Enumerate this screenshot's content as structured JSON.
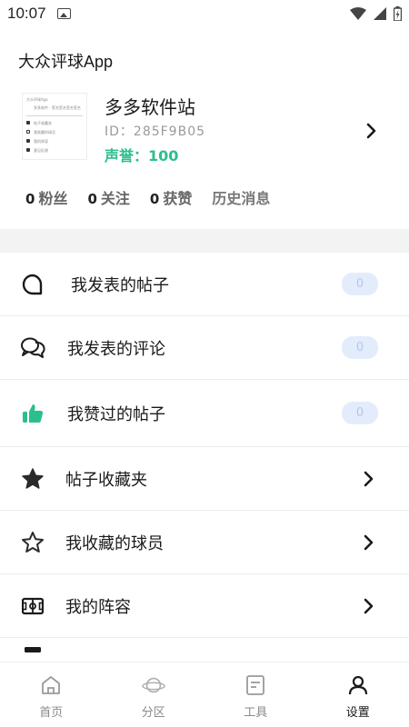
{
  "status_bar": {
    "time": "10:07",
    "icons": [
      "image-icon",
      "wifi-icon",
      "signal-icon",
      "battery-icon"
    ]
  },
  "app": {
    "title": "大众评球App"
  },
  "profile": {
    "name": "多多软件站",
    "id": "ID：285F9B05",
    "reputation": "声誉：100",
    "accent_color": "#2bbf8e",
    "thumbnail_lines": [
      "大众评球App",
      "多多软件 · 签名签名签名签名",
      "帖子收藏夹",
      "我收藏的球员",
      "我的阵容",
      "意见反馈"
    ]
  },
  "stats": [
    {
      "num": "0",
      "label": "粉丝"
    },
    {
      "num": "0",
      "label": "关注"
    },
    {
      "num": "0",
      "label": "获赞"
    }
  ],
  "history": "历史消息",
  "menu": [
    {
      "label": "我发表的帖子",
      "icon": "chat-bubble-icon",
      "badge": "0"
    },
    {
      "label": "我发表的评论",
      "icon": "comments-icon",
      "badge": "0"
    },
    {
      "label": "我赞过的帖子",
      "icon": "thumbs-up-icon",
      "badge": "0"
    },
    {
      "label": "帖子收藏夹",
      "icon": "star-filled-icon"
    },
    {
      "label": "我收藏的球员",
      "icon": "star-outline-icon"
    },
    {
      "label": "我的阵容",
      "icon": "lineup-icon"
    }
  ],
  "nav": [
    {
      "label": "首页",
      "icon": "home-icon"
    },
    {
      "label": "分区",
      "icon": "planet-icon"
    },
    {
      "label": "工具",
      "icon": "document-icon"
    },
    {
      "label": "设置",
      "icon": "user-icon",
      "active": true
    }
  ],
  "colors": {
    "badge_bg": "#e3ecfa",
    "badge_text": "#b2c8e8",
    "thumbs_up_green": "#2bbf8e"
  }
}
